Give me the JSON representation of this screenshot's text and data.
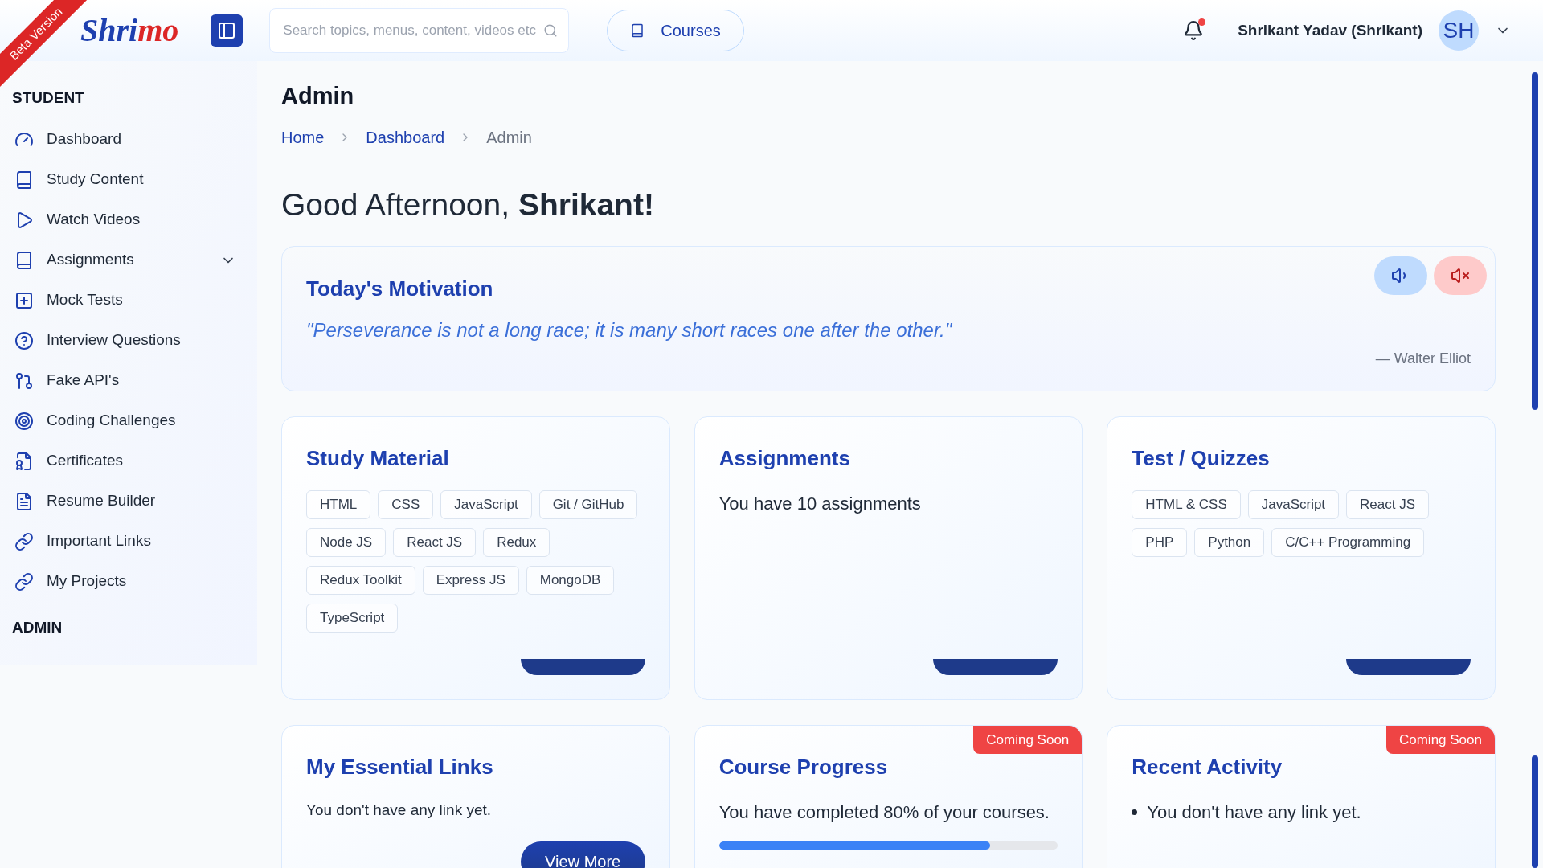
{
  "header": {
    "ribbon": "Beta Version",
    "logo": {
      "start": "Shri",
      "end": "mo"
    },
    "search": {
      "placeholder": "Search topics, menus, content, videos etc"
    },
    "courses_button": "Courses",
    "notification": {
      "unread": true
    },
    "user": {
      "name": "Shrikant Yadav (Shrikant)",
      "initials": "SH"
    }
  },
  "sidebar": {
    "sections": [
      {
        "title": "STUDENT",
        "items": [
          {
            "label": "Dashboard",
            "expandable": false
          },
          {
            "label": "Study Content",
            "expandable": false
          },
          {
            "label": "Watch Videos",
            "expandable": false
          },
          {
            "label": "Assignments",
            "expandable": true
          },
          {
            "label": "Mock Tests",
            "expandable": false
          },
          {
            "label": "Interview Questions",
            "expandable": false
          },
          {
            "label": "Fake API's",
            "expandable": false
          },
          {
            "label": "Coding Challenges",
            "expandable": false
          },
          {
            "label": "Certificates",
            "expandable": false
          },
          {
            "label": "Resume Builder",
            "expandable": false
          },
          {
            "label": "Important Links",
            "expandable": false
          },
          {
            "label": "My Projects",
            "expandable": false
          }
        ]
      },
      {
        "title": "ADMIN"
      }
    ]
  },
  "page": {
    "title": "Admin",
    "breadcrumbs": [
      {
        "label": "Home",
        "current": false
      },
      {
        "label": "Dashboard",
        "current": false
      },
      {
        "label": "Admin",
        "current": true
      }
    ],
    "greeting": "Good Afternoon, **Shrikant!**"
  },
  "motivation": {
    "title": "Today's Motivation",
    "quote": "\"Perseverance is not a long race; it is many short races one after the other.\"",
    "author": "— Walter Elliot"
  },
  "cards": [
    {
      "kind": "tags",
      "title": "Study Material",
      "tags": [
        "HTML",
        "CSS",
        "JavaScript",
        "Git / GitHub",
        "Node JS",
        "React JS",
        "Redux",
        "Redux Toolkit",
        "Express JS",
        "MongoDB",
        "TypeScript"
      ],
      "button": {
        "clipped": true
      }
    },
    {
      "kind": "text",
      "title": "Assignments",
      "text": "You have 10 assignments",
      "large": true,
      "button": {
        "clipped": true
      }
    },
    {
      "kind": "tags",
      "title": "Test / Quizzes",
      "tags": [
        "HTML & CSS",
        "JavaScript",
        "React JS",
        "PHP",
        "Python",
        "C/C++ Programming"
      ],
      "button": {
        "clipped": true
      }
    },
    {
      "kind": "text",
      "title": "My Essential Links",
      "text": "You don't have any link yet.",
      "large": false,
      "button": {
        "clipped": false,
        "label": "View More"
      }
    },
    {
      "kind": "progress",
      "title": "Course Progress",
      "badge": "Coming Soon",
      "text": "You have completed 80% of your courses.",
      "level": 0.8
    },
    {
      "kind": "list",
      "title": "Recent Activity",
      "badge": "Coming Soon",
      "items": [
        "You don't have any link yet."
      ]
    }
  ]
}
